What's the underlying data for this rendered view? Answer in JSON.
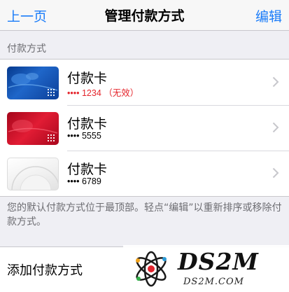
{
  "navbar": {
    "back_label": "上一页",
    "title": "管理付款方式",
    "edit_label": "编辑"
  },
  "section_header": "付款方式",
  "cards": [
    {
      "name": "付款卡",
      "number": "•••• 1234 （无效）",
      "status": "invalid",
      "theme": "blue"
    },
    {
      "name": "付款卡",
      "number": "•••• 5555",
      "status": "valid",
      "theme": "red"
    },
    {
      "name": "付款卡",
      "number": "•••• 6789",
      "status": "valid",
      "theme": "white"
    }
  ],
  "footer_note": "您的默认付款方式位于最顶部。轻点“编辑”以重新排序或移除付款方式。",
  "add_payment_label": "添加付款方式",
  "watermark": {
    "big": "DS2M",
    "small": "DS2M.COM"
  },
  "colors": {
    "accent": "#1a7cf9",
    "invalid": "#e4242b",
    "background": "#efeff4"
  }
}
